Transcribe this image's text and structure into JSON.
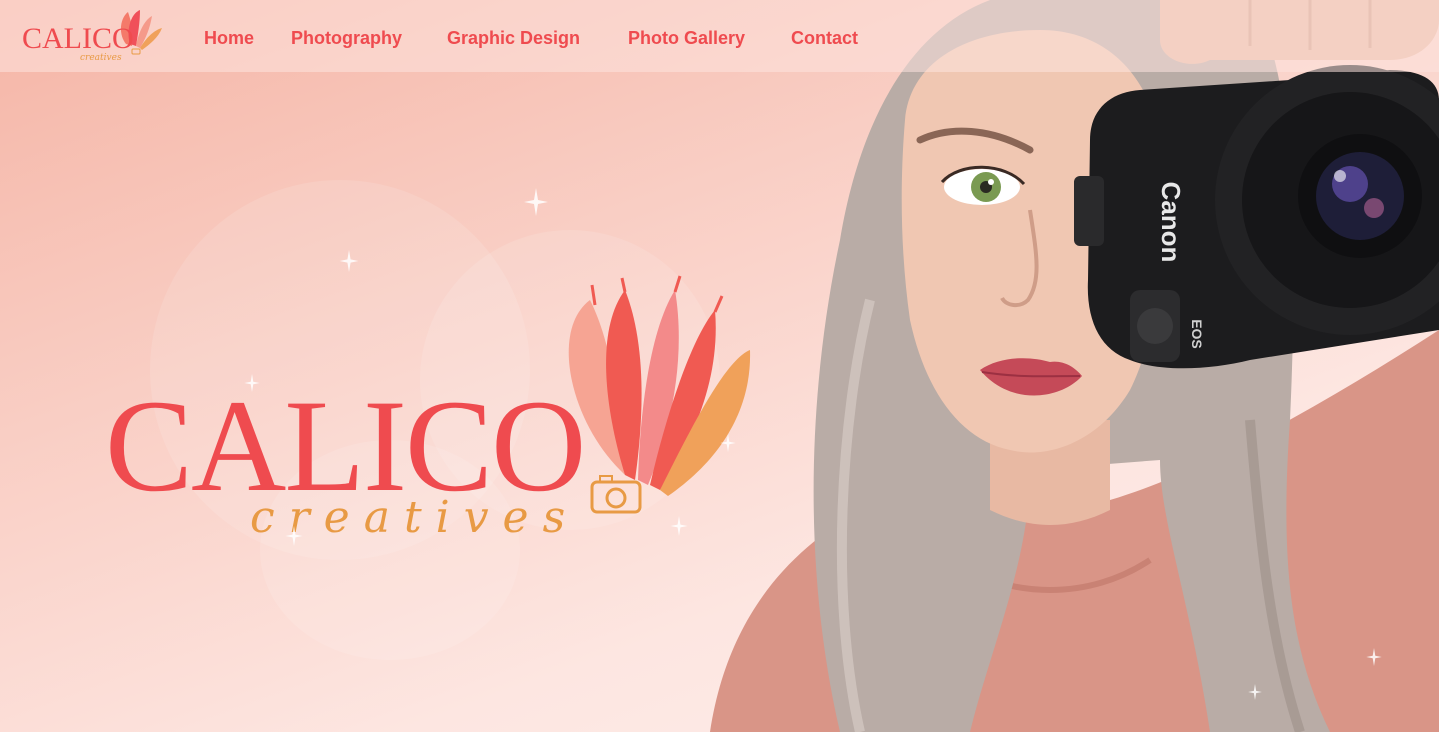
{
  "brand": {
    "name": "CALICO",
    "tagline": "creatives"
  },
  "nav": {
    "items": [
      {
        "label": "Home"
      },
      {
        "label": "Photography"
      },
      {
        "label": "Graphic Design"
      },
      {
        "label": "Photo Gallery"
      },
      {
        "label": "Contact"
      }
    ]
  },
  "camera": {
    "brand": "Canon",
    "model": "EOS"
  },
  "colors": {
    "accent": "#ef4b4f",
    "tagline": "#e89a44",
    "background_top": "#f5b5a6",
    "background_bottom": "#fdeeeb"
  }
}
